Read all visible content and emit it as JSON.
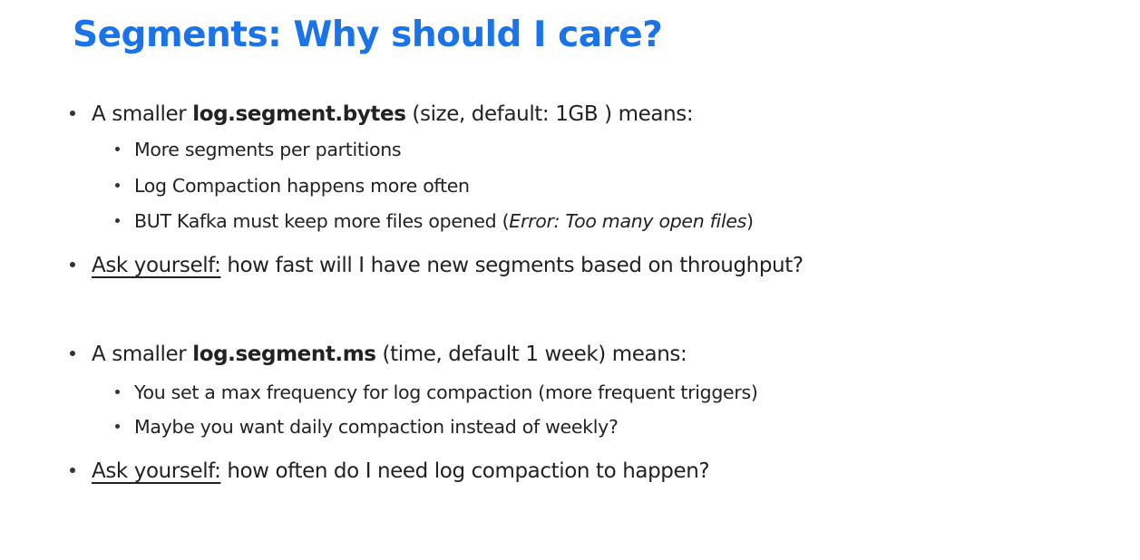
{
  "slide": {
    "title": "Segments: Why should I care?",
    "block1": {
      "prefix": "A smaller ",
      "keyword": "log.segment.bytes",
      "suffix": " (size, default: 1GB ) means:",
      "sub1": "More segments per partitions",
      "sub2": "Log Compaction happens more often",
      "sub3_prefix": "BUT Kafka must keep more files opened (",
      "sub3_italic": "Error: Too many open files",
      "sub3_suffix": ")",
      "ask_label": "Ask yourself:",
      "ask_text": " how fast will I have new segments based on throughput?"
    },
    "block2": {
      "prefix": "A smaller ",
      "keyword": "log.segment.ms",
      "suffix": " (time, default 1 week) means:",
      "sub1": "You set a max frequency for log compaction (more frequent triggers)",
      "sub2": "Maybe you want daily compaction instead of weekly?",
      "ask_label": "Ask yourself:",
      "ask_text": " how often do I need log compaction to happen?"
    }
  }
}
